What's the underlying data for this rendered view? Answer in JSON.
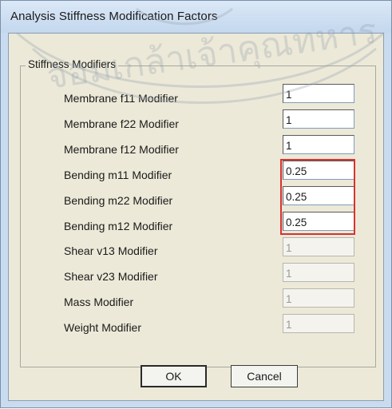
{
  "window": {
    "title": "Analysis Stiffness Modification Factors"
  },
  "group": {
    "title": "Stiffness Modifiers"
  },
  "modifiers": [
    {
      "label": "Membrane f11 Modifier",
      "value": "1"
    },
    {
      "label": "Membrane f22 Modifier",
      "value": "1"
    },
    {
      "label": "Membrane f12 Modifier",
      "value": "1"
    },
    {
      "label": "Bending  m11 Modifier",
      "value": "0.25"
    },
    {
      "label": "Bending  m22 Modifier",
      "value": "0.25"
    },
    {
      "label": "Bending  m12 Modifier",
      "value": "0.25"
    },
    {
      "label": "Shear  v13 Modifier",
      "value": "1"
    },
    {
      "label": "Shear  v23 Modifier",
      "value": "1"
    },
    {
      "label": "Mass Modifier",
      "value": "1"
    },
    {
      "label": "Weight Modifier",
      "value": "1"
    }
  ],
  "buttons": {
    "ok": "OK",
    "cancel": "Cancel"
  },
  "highlight_color": "#d9322f",
  "watermark_text": "จอมเกล้าเจ้าคุณทหาร"
}
